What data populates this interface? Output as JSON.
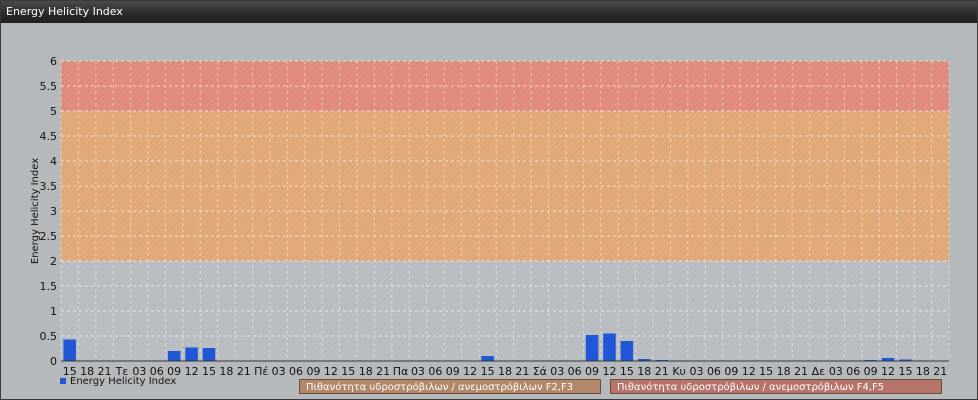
{
  "window": {
    "title": "Energy Helicity Index"
  },
  "chart_data": {
    "type": "bar",
    "ylabel": "Energy Helicity Index",
    "ylim": [
      0,
      6
    ],
    "yticks": [
      "0",
      "0.5",
      "1",
      "1.5",
      "2",
      "2.5",
      "3",
      "3.5",
      "4",
      "4.5",
      "5",
      "5.5",
      "6"
    ],
    "categories": [
      "15",
      "18",
      "21",
      "Τε",
      "03",
      "06",
      "09",
      "12",
      "15",
      "18",
      "21",
      "Πέ",
      "03",
      "06",
      "09",
      "12",
      "15",
      "18",
      "21",
      "Πα",
      "03",
      "06",
      "09",
      "12",
      "15",
      "18",
      "21",
      "Σά",
      "03",
      "06",
      "09",
      "12",
      "15",
      "18",
      "21",
      "Κυ",
      "03",
      "06",
      "09",
      "12",
      "15",
      "18",
      "21",
      "Δε",
      "03",
      "06",
      "09",
      "12",
      "15",
      "18",
      "21"
    ],
    "series": [
      {
        "name": "Energy Helicity Index",
        "values": [
          0.43,
          0.01,
          0.01,
          0.01,
          0.01,
          0.01,
          0.2,
          0.27,
          0.26,
          0.01,
          0.01,
          0.01,
          0.01,
          0.01,
          0.01,
          0.01,
          0.01,
          0.01,
          0.01,
          0.01,
          0.01,
          0.01,
          0.01,
          0.01,
          0.1,
          0.01,
          0.01,
          0.01,
          0.01,
          0.01,
          0.52,
          0.55,
          0.4,
          0.04,
          0.02,
          0.01,
          0.01,
          0.01,
          0.01,
          0.01,
          0.01,
          0.01,
          0.01,
          0.01,
          0.01,
          0.01,
          0.02,
          0.06,
          0.03,
          0.01,
          0.01
        ],
        "color": "#1f57d6"
      }
    ],
    "bands": [
      {
        "from": 2,
        "to": 5,
        "color": "#e1a877",
        "label": "Πιθανότητα υδροστρόβιλων / ανεμοστρόβιλων F2,F3"
      },
      {
        "from": 5,
        "to": 6,
        "color": "#e08a7a",
        "label": "Πιθανότητα υδροστρόβιλων / ανεμοστρόβιλων F4,F5"
      }
    ],
    "grid": true,
    "legend_position": "bottom-left"
  }
}
